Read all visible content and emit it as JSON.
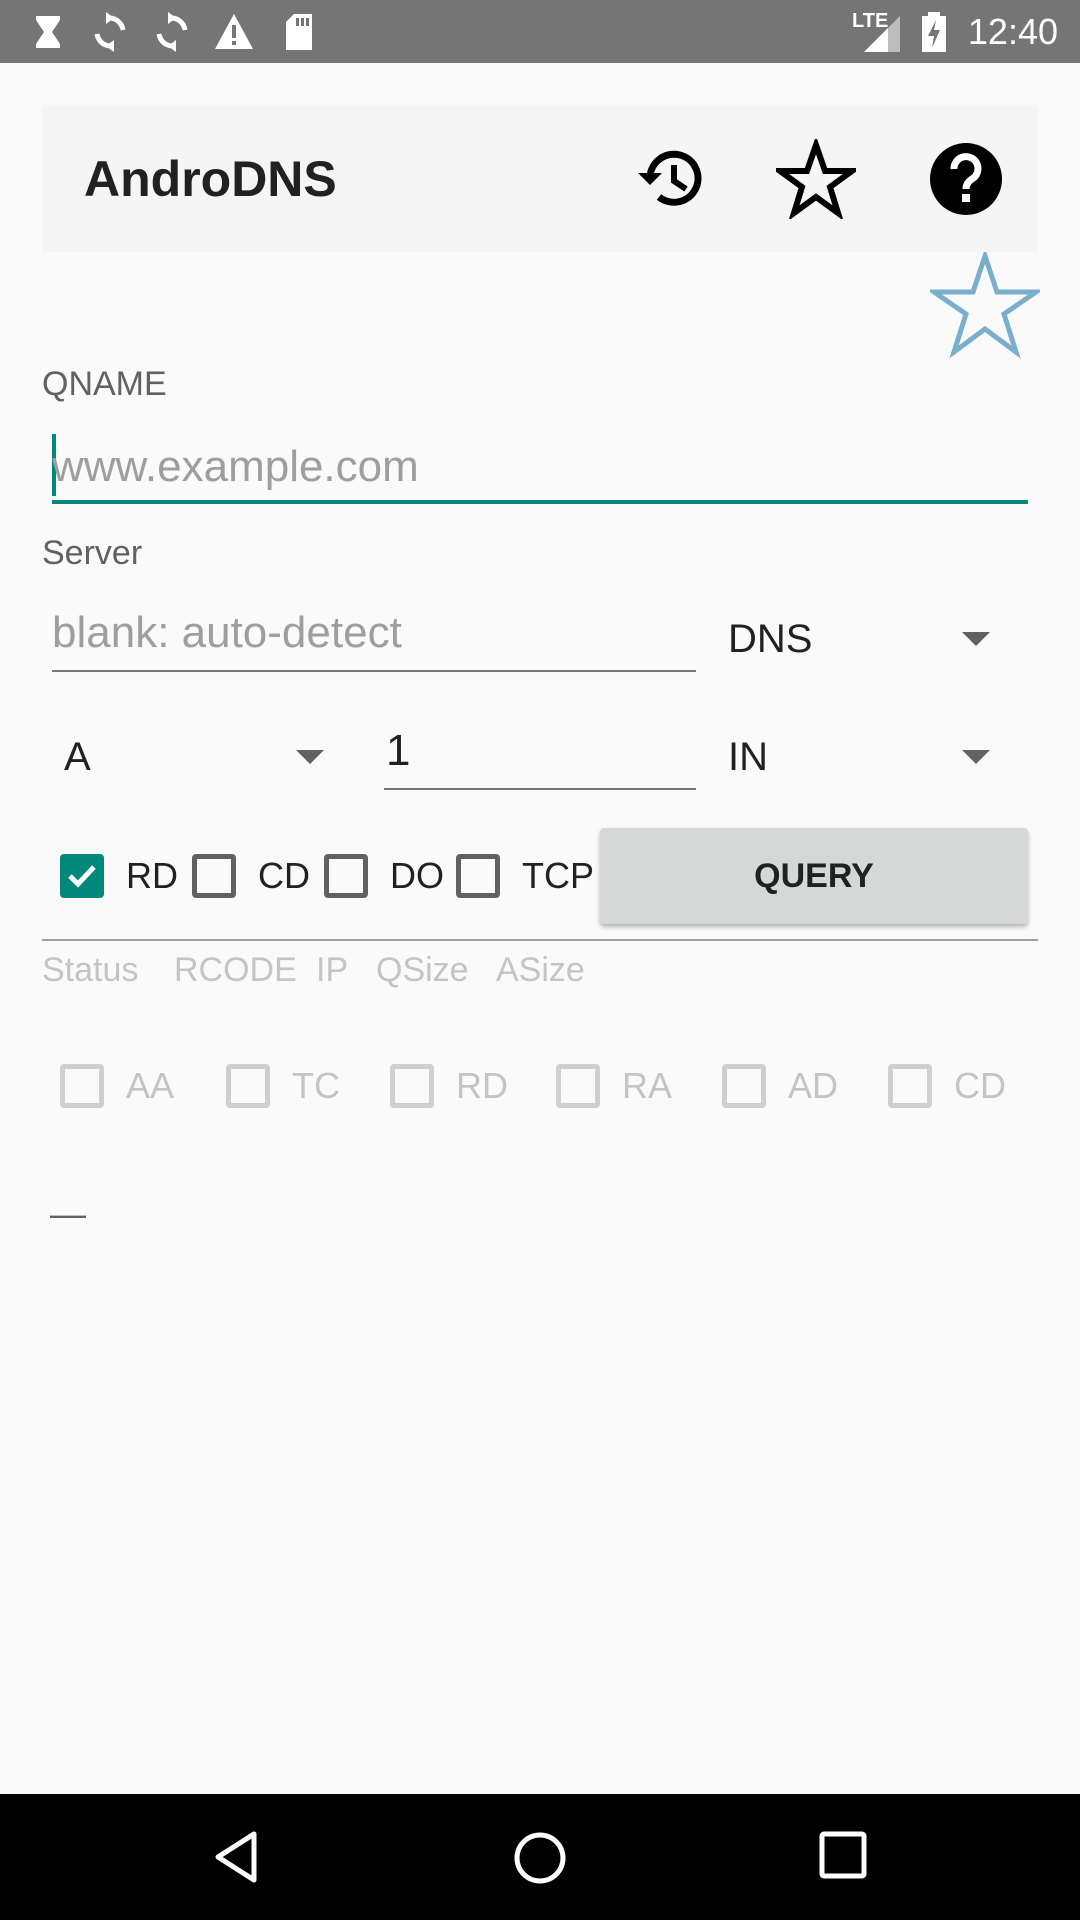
{
  "status_bar": {
    "time": "12:40",
    "network": "LTE",
    "icons": [
      "hourglass-icon",
      "sync-icon",
      "sync-icon",
      "warning-icon",
      "sd-card-icon",
      "signal-icon",
      "battery-charging-icon"
    ]
  },
  "app_bar": {
    "title": "AndroDNS",
    "actions": [
      "history-icon",
      "star-icon",
      "help-icon"
    ]
  },
  "favorite": {
    "icon": "star-outline-icon",
    "color": "#7aaecd"
  },
  "qname": {
    "label": "QNAME",
    "placeholder": "www.example.com",
    "value": ""
  },
  "server": {
    "label": "Server",
    "placeholder": "blank: auto-detect",
    "value": "",
    "protocol": "DNS"
  },
  "query_params": {
    "type": "A",
    "count": "1",
    "class": "IN"
  },
  "flags": [
    {
      "label": "RD",
      "checked": true
    },
    {
      "label": "CD",
      "checked": false
    },
    {
      "label": "DO",
      "checked": false
    },
    {
      "label": "TCP",
      "checked": false
    }
  ],
  "query_button": {
    "label": "QUERY"
  },
  "result_header": {
    "status": "Status",
    "rcode": "RCODE",
    "ip": "IP",
    "qsize": "QSize",
    "asize": "ASize"
  },
  "response_flags": [
    {
      "label": "AA",
      "checked": false
    },
    {
      "label": "TC",
      "checked": false
    },
    {
      "label": "RD",
      "checked": false
    },
    {
      "label": "RA",
      "checked": false
    },
    {
      "label": "AD",
      "checked": false
    },
    {
      "label": "CD",
      "checked": false
    }
  ],
  "result_body": "—",
  "colors": {
    "accent": "#00897b",
    "status_bar": "#757575",
    "app_bar": "#f5f5f5",
    "button": "#d6d7d7"
  },
  "nav_bar": {
    "icons": [
      "back-icon",
      "home-icon",
      "recents-icon"
    ]
  }
}
